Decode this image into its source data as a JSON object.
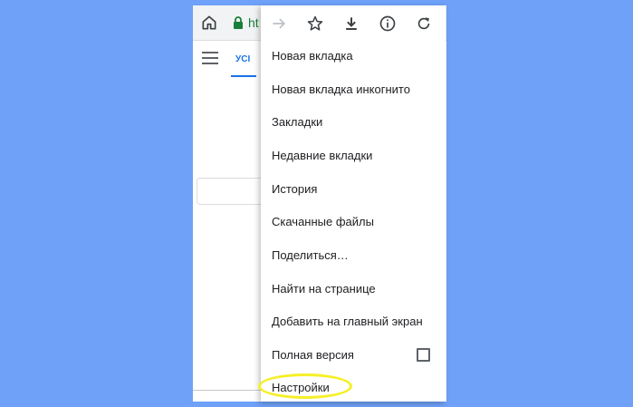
{
  "browser": {
    "url_partial": "ht",
    "tab_label": "УСІ"
  },
  "menu": {
    "items": [
      "Новая вкладка",
      "Новая вкладка инкогнито",
      "Закладки",
      "Недавние вкладки",
      "История",
      "Скачанные файлы",
      "Поделиться…",
      "Найти на странице",
      "Добавить на главный экран",
      "Полная версия",
      "Настройки"
    ],
    "icons": [
      "forward-icon",
      "star-icon",
      "download-icon",
      "info-icon",
      "reload-icon"
    ]
  },
  "colors": {
    "background": "#6ea1f7",
    "highlight": "#f6ef28",
    "accent": "#1a73e8",
    "secure_green": "#188038"
  }
}
